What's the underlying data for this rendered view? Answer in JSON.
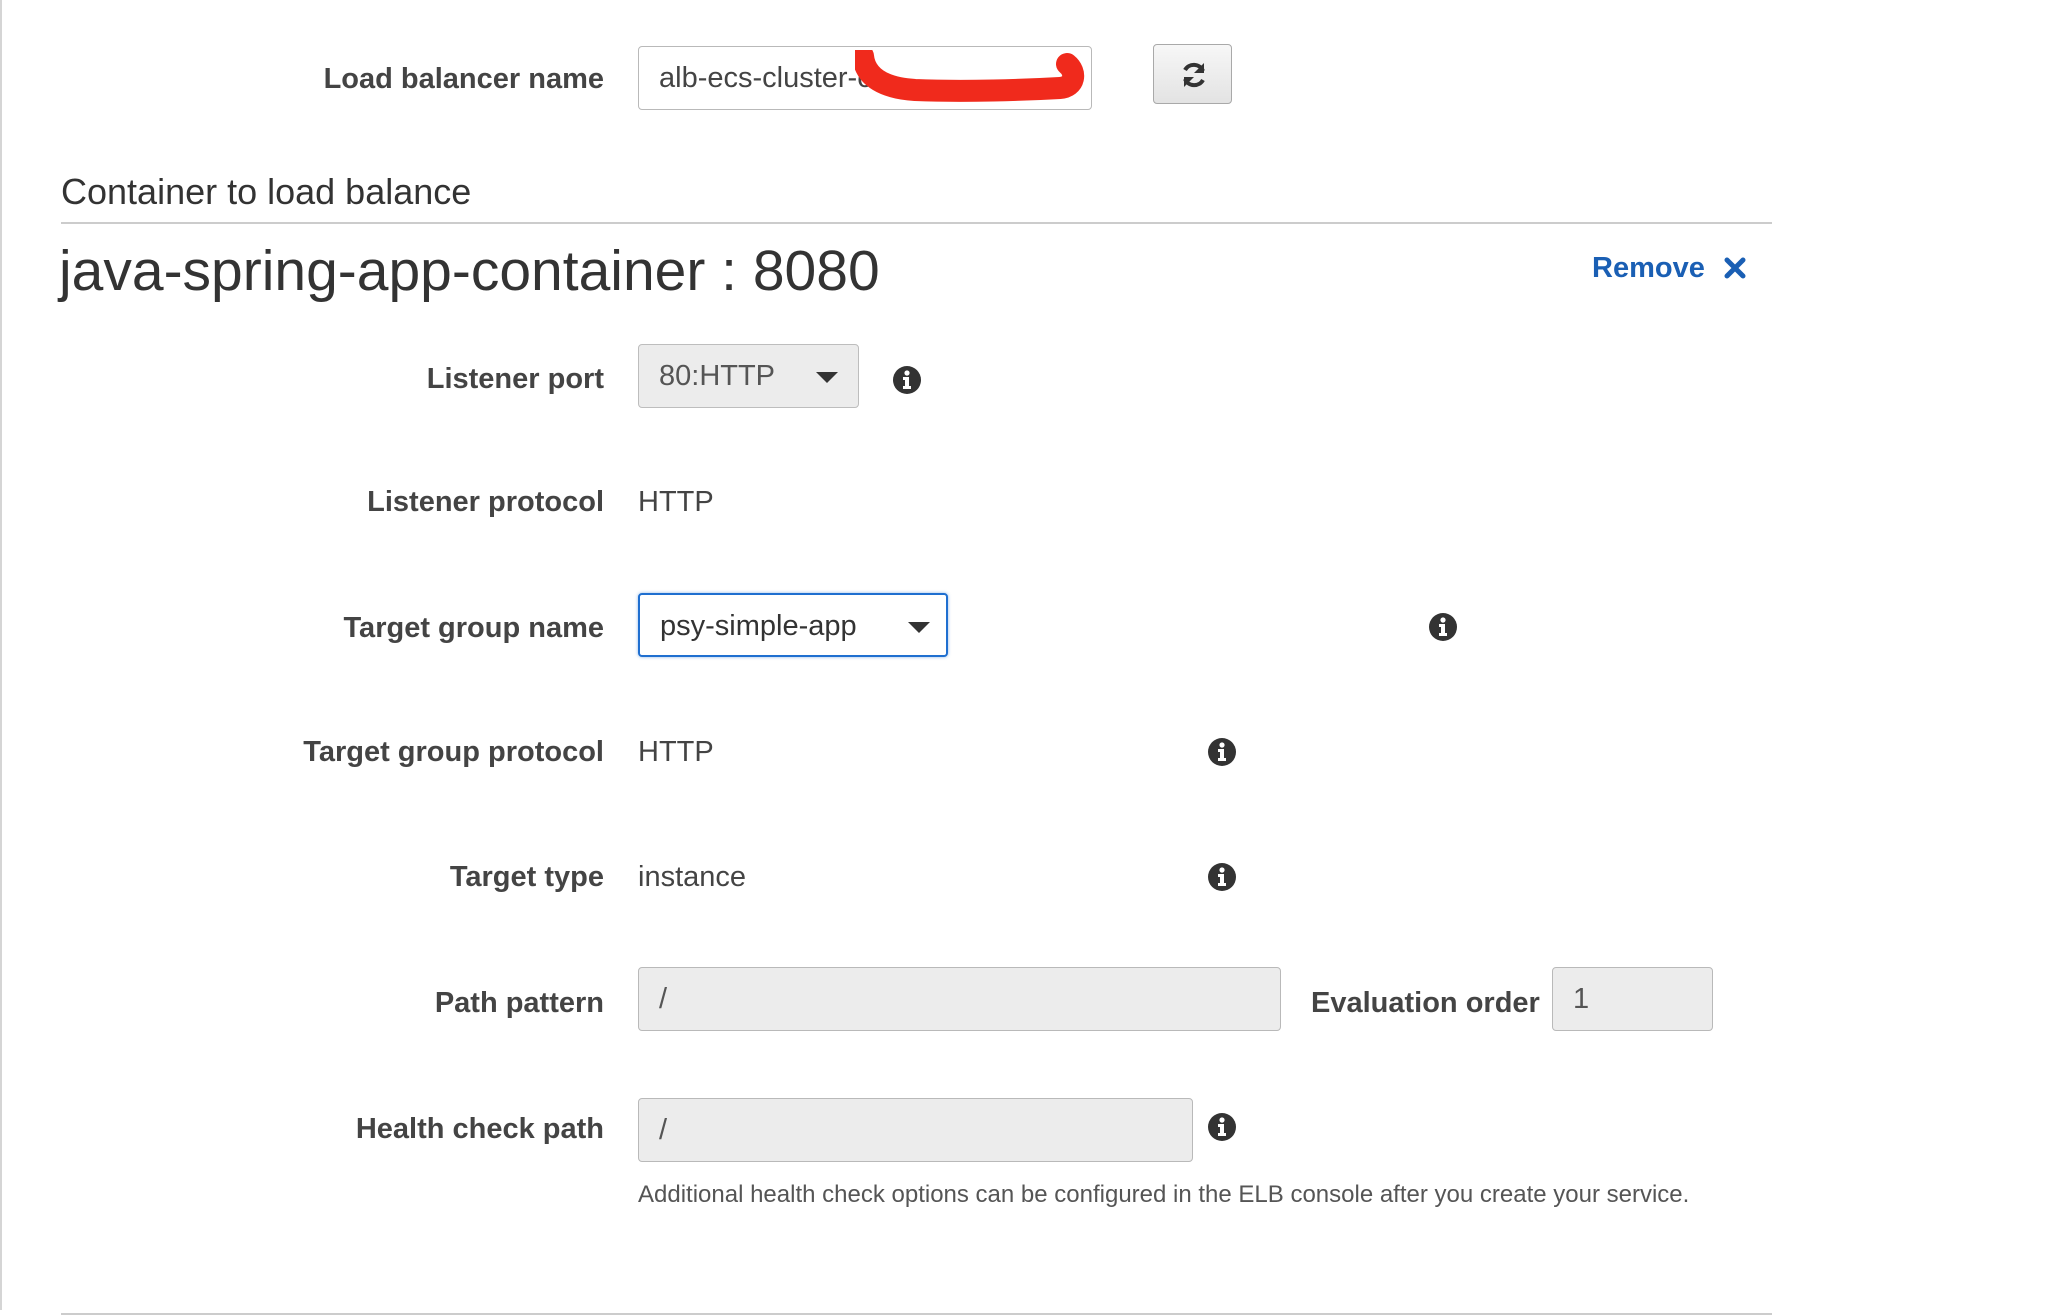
{
  "load_balancer": {
    "label": "Load balancer name",
    "value": "alb-ecs-cluster-c"
  },
  "section": {
    "title": "Container to load balance"
  },
  "container": {
    "title": "java-spring-app-container : 8080",
    "remove_label": "Remove"
  },
  "listener_port": {
    "label": "Listener port",
    "value": "80:HTTP"
  },
  "listener_protocol": {
    "label": "Listener protocol",
    "value": "HTTP"
  },
  "target_group_name": {
    "label": "Target group name",
    "value": "psy-simple-app"
  },
  "target_group_protocol": {
    "label": "Target group protocol",
    "value": "HTTP"
  },
  "target_type": {
    "label": "Target type",
    "value": "instance"
  },
  "path_pattern": {
    "label": "Path pattern",
    "value": "/"
  },
  "evaluation_order": {
    "label": "Evaluation order",
    "value": "1"
  },
  "health_check_path": {
    "label": "Health check path",
    "value": "/",
    "help": "Additional health check options can be configured in the ELB console after you create your service."
  },
  "icons": {
    "refresh": "refresh-icon",
    "info": "info-icon",
    "remove": "close-icon",
    "dropdown": "chevron-down-icon"
  },
  "colors": {
    "link": "#1a5fb4",
    "focus_border": "#1f6fd0",
    "redaction": "#f02a1c"
  }
}
